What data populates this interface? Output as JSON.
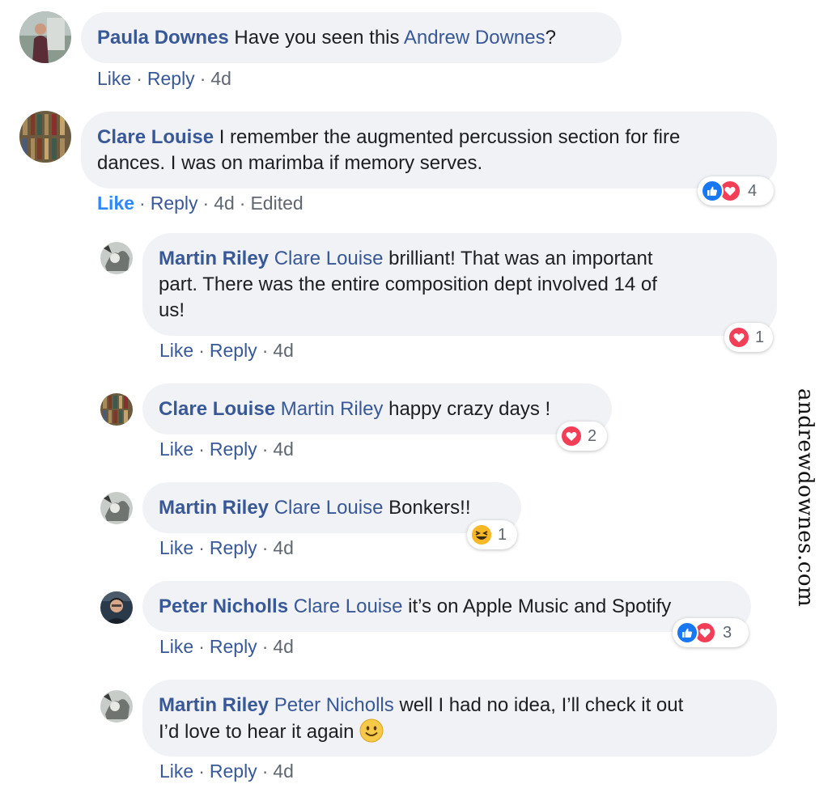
{
  "actions": {
    "like": "Like",
    "reply": "Reply",
    "dot": "·",
    "edited": "Edited"
  },
  "comments": [
    {
      "author": "Paula Downes",
      "text_before": "Have you seen this ",
      "mention": "Andrew Downes",
      "text_after": "?",
      "time": "4d"
    },
    {
      "author": "Clare Louise",
      "line1": "I remember the augmented percussion section for fire",
      "line2": "dances. I was on marimba if memory serves.",
      "time": "4d",
      "liked": true,
      "reactions": {
        "icons": [
          "like-icon",
          "love-icon"
        ],
        "count": "4"
      }
    },
    {
      "author": "Martin Riley",
      "mention": "Clare Louise",
      "line1": "brilliant! That was an important",
      "line2": "part. There was the entire composition dept involved 14 of",
      "line3": "us!",
      "time": "4d",
      "reactions": {
        "icons": [
          "love-icon"
        ],
        "count": "1"
      }
    },
    {
      "author": "Clare Louise",
      "mention": "Martin Riley",
      "text": "happy crazy days !",
      "time": "4d",
      "reactions": {
        "icons": [
          "love-icon"
        ],
        "count": "2"
      }
    },
    {
      "author": "Martin Riley",
      "mention": "Clare Louise",
      "text": "Bonkers!!",
      "time": "4d",
      "reactions": {
        "icons": [
          "haha-icon"
        ],
        "count": "1"
      }
    },
    {
      "author": "Peter Nicholls",
      "mention": "Clare Louise",
      "text": "it’s on Apple Music and Spotify",
      "time": "4d",
      "reactions": {
        "icons": [
          "like-icon",
          "love-icon"
        ],
        "count": "3"
      }
    },
    {
      "author": "Martin Riley",
      "mention": "Peter Nicholls",
      "line1": "well I had no idea, I’ll check it out",
      "line2": "I’d love to hear it again",
      "emoji": "slightly-smiling-face-icon",
      "time": "4d"
    }
  ],
  "watermark": "andrewdownes.com",
  "colors": {
    "link": "#385898",
    "liked": "#2d88ff",
    "bubble": "#f0f2f5",
    "love": "#f33e58",
    "like": "#1877f2",
    "haha": "#f7b928"
  }
}
